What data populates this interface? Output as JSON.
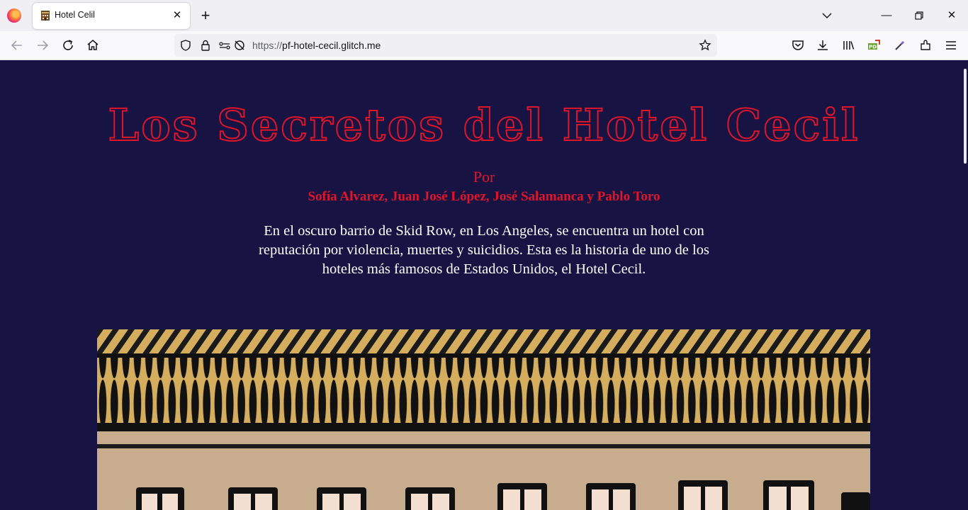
{
  "browser": {
    "tab": {
      "title": "Hotel Celil",
      "favicon": "hotel-building-icon"
    },
    "url": {
      "protocol": "https://",
      "host": "pf-hotel-cecil.glitch.me"
    },
    "colors": {
      "tab_bg": "#ffffff",
      "chrome_bg": "#f0f0f4",
      "toolbar_bg": "#f9f9fb"
    }
  },
  "page": {
    "title": "Los Secretos del Hotel Cecil",
    "by": "Por",
    "authors": "Sofía Alvarez, Juan José López, José Salamanca y Pablo Toro",
    "intro": "En el oscuro barrio de Skid Row, en Los Angeles, se encuentra un hotel con reputación por violencia, muertes y suicidios. Esta es la historia de uno de los hoteles más famosos de Estados Unidos, el Hotel Cecil.",
    "illustration": "hotel-facade-illustration",
    "colors": {
      "background": "#171444",
      "accent": "#e0152a",
      "text": "#ffffff",
      "gold": "#d4ae5e",
      "wall": "#c7ac8d"
    }
  }
}
